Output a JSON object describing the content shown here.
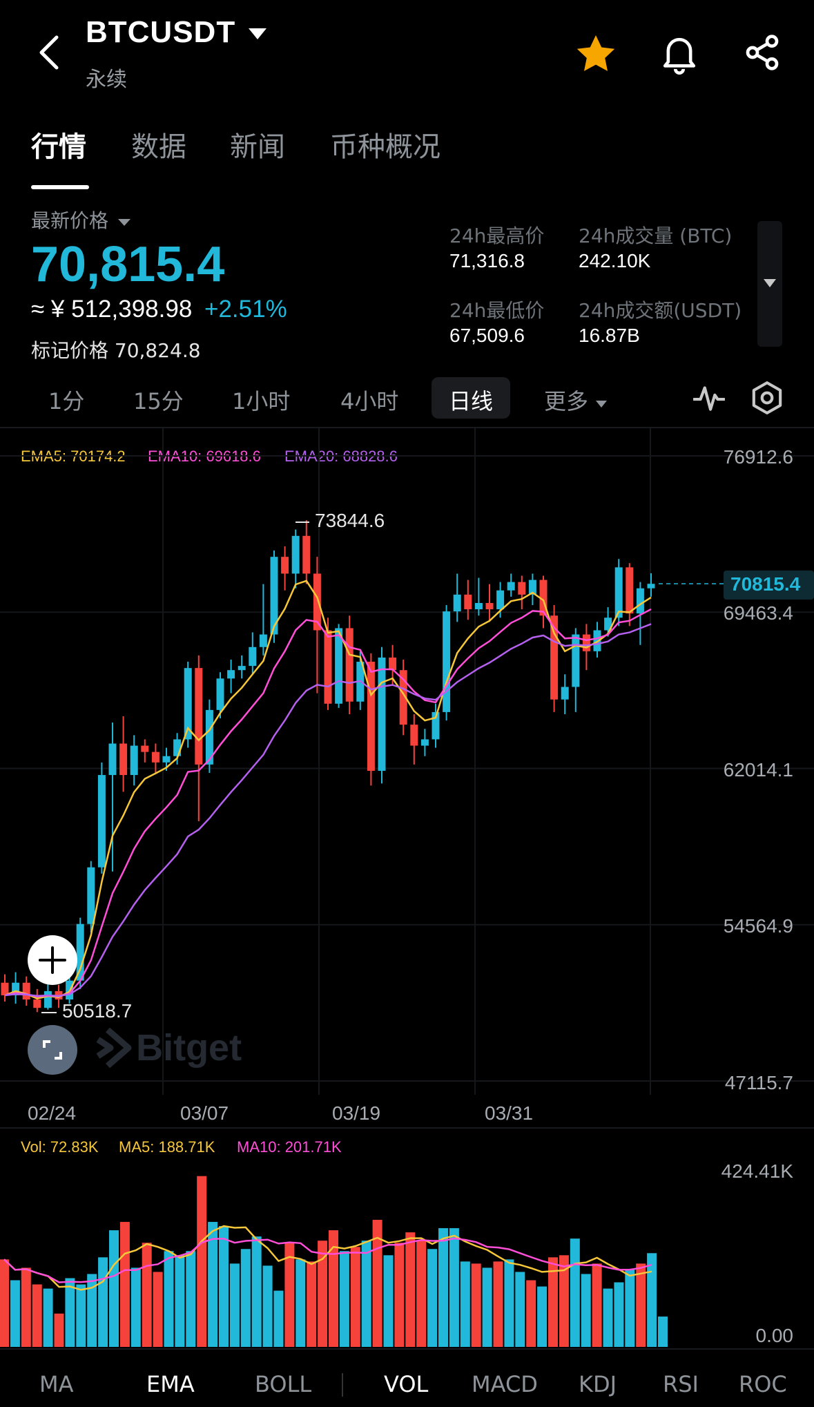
{
  "header": {
    "symbol": "BTCUSDT",
    "contract_type": "永续",
    "back_icon": "chevron-left-icon",
    "favorite_color": "#f7a600"
  },
  "tabs": [
    "行情",
    "数据",
    "新闻",
    "币种概况"
  ],
  "ticker": {
    "latest_label": "最新价格",
    "last_price": "70,815.4",
    "cny_price": "≈ ¥ 512,398.98",
    "change": "+2.51%",
    "mark_price": "标记价格 70,824.8",
    "high_label": "24h最高价",
    "high_value": "71,316.8",
    "low_label": "24h最低价",
    "low_value": "67,509.6",
    "vol_label": "24h成交量 (BTC)",
    "vol_value": "242.10K",
    "turnover_label": "24h成交额(USDT)",
    "turnover_value": "16.87B",
    "up_color": "#21b8da",
    "down_color": "#f5433b"
  },
  "timeframes": [
    "1分",
    "15分",
    "1小时",
    "4小时",
    "日线",
    "更多"
  ],
  "active_timeframe": "日线",
  "chart_data": {
    "type": "candlestick",
    "ema_labels": {
      "ema5": "EMA5: 70174.2",
      "ema10": "EMA10: 69618.6",
      "ema20": "EMA20: 68828.6"
    },
    "ema_colors": {
      "ema5": "#f7c73a",
      "ema10": "#ff4fd8",
      "ema20": "#b561f0"
    },
    "y_ticks": [
      "76912.6",
      "69463.4",
      "62014.1",
      "54564.9",
      "47115.7"
    ],
    "y_tick_values": [
      76912.6,
      69463.4,
      62014.1,
      54564.9,
      47115.7
    ],
    "ylim": [
      47115.7,
      76912.6
    ],
    "x_ticks": [
      "02/24",
      "03/07",
      "03/19",
      "03/31"
    ],
    "max_label": "73844.6",
    "min_label": "50518.7",
    "last_price_tag": "70815.4",
    "candles": [
      [
        51800,
        51200,
        52200,
        50900
      ],
      [
        51200,
        51800,
        52300,
        50800
      ],
      [
        51800,
        51000,
        52100,
        50700
      ],
      [
        51000,
        50600,
        51500,
        50400
      ],
      [
        50600,
        51400,
        51900,
        50518.7
      ],
      [
        51400,
        51000,
        51700,
        50600
      ],
      [
        51000,
        51900,
        52200,
        50800
      ],
      [
        51900,
        54600,
        54900,
        51500
      ],
      [
        54600,
        57300,
        57600,
        54200
      ],
      [
        57300,
        61700,
        62300,
        57000
      ],
      [
        61700,
        63200,
        64200,
        57100
      ],
      [
        63200,
        61700,
        64500,
        60900
      ],
      [
        61700,
        63100,
        63600,
        61200
      ],
      [
        63100,
        62800,
        63400,
        62300
      ],
      [
        62800,
        62300,
        63200,
        61800
      ],
      [
        62300,
        62600,
        63000,
        61900
      ],
      [
        62600,
        63400,
        63700,
        62200
      ],
      [
        63400,
        66800,
        67100,
        63000
      ],
      [
        66800,
        62200,
        67400,
        59500
      ],
      [
        62200,
        64800,
        65300,
        61800
      ],
      [
        64800,
        66300,
        66600,
        64400
      ],
      [
        66300,
        66700,
        67200,
        65600
      ],
      [
        66700,
        66900,
        67400,
        66300
      ],
      [
        66900,
        67800,
        68500,
        66500
      ],
      [
        67800,
        68400,
        70800,
        67400
      ],
      [
        68400,
        72100,
        72400,
        68000
      ],
      [
        72100,
        71300,
        72600,
        70500
      ],
      [
        71300,
        73100,
        73400,
        70600
      ],
      [
        73100,
        71300,
        73844.6,
        70800
      ],
      [
        71300,
        68600,
        72100,
        65600
      ],
      [
        68600,
        65100,
        69200,
        64800
      ],
      [
        65100,
        68700,
        68900,
        64900
      ],
      [
        68700,
        65200,
        69300,
        64600
      ],
      [
        65200,
        67100,
        67600,
        64800
      ],
      [
        67100,
        61900,
        67500,
        61200
      ],
      [
        61900,
        67300,
        67800,
        61300
      ],
      [
        67300,
        66700,
        67900,
        66000
      ],
      [
        66700,
        64100,
        67200,
        63600
      ],
      [
        64100,
        63100,
        64600,
        62200
      ],
      [
        63100,
        63400,
        63900,
        62600
      ],
      [
        63400,
        64700,
        65100,
        63000
      ],
      [
        64700,
        69500,
        69800,
        64300
      ],
      [
        69500,
        70300,
        71300,
        69000
      ],
      [
        70300,
        69600,
        71000,
        69100
      ],
      [
        69600,
        69900,
        71100,
        69300
      ],
      [
        69900,
        69600,
        70800,
        69000
      ],
      [
        69600,
        70500,
        70900,
        69200
      ],
      [
        70500,
        70900,
        71300,
        70200
      ],
      [
        70900,
        70300,
        71200,
        69600
      ],
      [
        70300,
        71000,
        71300,
        69800
      ],
      [
        71000,
        69300,
        71200,
        68700
      ],
      [
        69300,
        65300,
        69800,
        64700
      ],
      [
        65300,
        65900,
        66500,
        64600
      ],
      [
        65900,
        68400,
        68700,
        64700
      ],
      [
        68400,
        67600,
        68900,
        66700
      ],
      [
        67600,
        68600,
        69000,
        67300
      ],
      [
        68600,
        69200,
        69700,
        68300
      ],
      [
        69200,
        71600,
        72000,
        68800
      ],
      [
        71600,
        69400,
        71800,
        68800
      ],
      [
        69400,
        70600,
        70900,
        67900
      ],
      [
        70600,
        70815.4,
        71316.8,
        70200
      ]
    ]
  },
  "volume_data": {
    "labels": {
      "vol": "Vol: 72.83K",
      "ma5": "MA5: 188.71K",
      "ma10": "MA10: 201.71K"
    },
    "y_ticks": [
      "424.41K",
      "0.00"
    ],
    "ylim": [
      0,
      424.41
    ],
    "values": [
      210,
      160,
      190,
      150,
      140,
      80,
      165,
      150,
      175,
      215,
      280,
      300,
      190,
      250,
      180,
      230,
      220,
      230,
      410,
      300,
      290,
      200,
      235,
      265,
      195,
      135,
      250,
      210,
      205,
      255,
      280,
      230,
      240,
      255,
      305,
      220,
      250,
      275,
      255,
      235,
      285,
      285,
      205,
      200,
      190,
      205,
      210,
      180,
      160,
      145,
      215,
      220,
      260,
      175,
      200,
      140,
      155,
      185,
      200,
      225,
      72.83
    ]
  },
  "indicators": [
    "MA",
    "EMA",
    "BOLL",
    "VOL",
    "MACD",
    "KDJ",
    "RSI",
    "ROC"
  ],
  "active_indicators": [
    "EMA",
    "VOL"
  ],
  "watermark": "Bitget"
}
